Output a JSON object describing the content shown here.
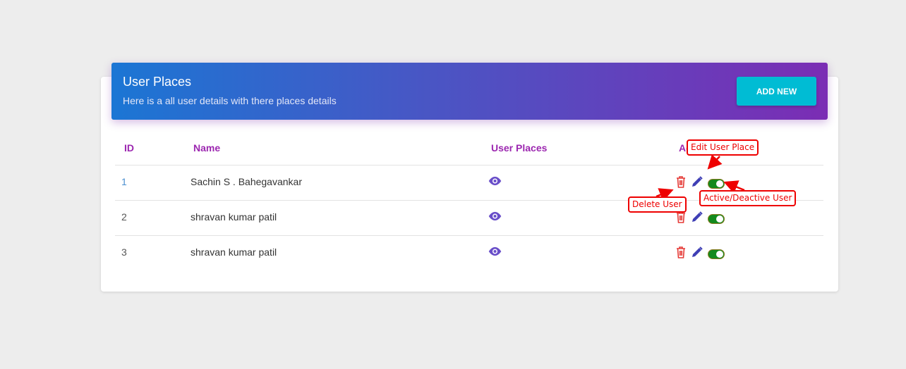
{
  "header": {
    "title": "User Places",
    "subtitle": "Here is a all user details with there places details",
    "add_button": "ADD NEW"
  },
  "table": {
    "columns": [
      "ID",
      "Name",
      "User Places",
      "Action"
    ],
    "rows": [
      {
        "id": "1",
        "name": "Sachin S . Bahegavankar",
        "active": true
      },
      {
        "id": "2",
        "name": "shravan kumar patil",
        "active": true
      },
      {
        "id": "3",
        "name": "shravan kumar patil",
        "active": true
      }
    ]
  },
  "annotations": {
    "edit": "Edit User Place",
    "delete": "Delete User",
    "toggle": "Active/Deactive User"
  },
  "colors": {
    "header_start": "#1b76d4",
    "header_end": "#7b2db4",
    "accent": "#9c27b0",
    "button": "#00bcd4",
    "delete": "#e53935",
    "edit": "#3f3fb5",
    "toggle_on": "#138a1d",
    "annotation": "#e00000"
  }
}
